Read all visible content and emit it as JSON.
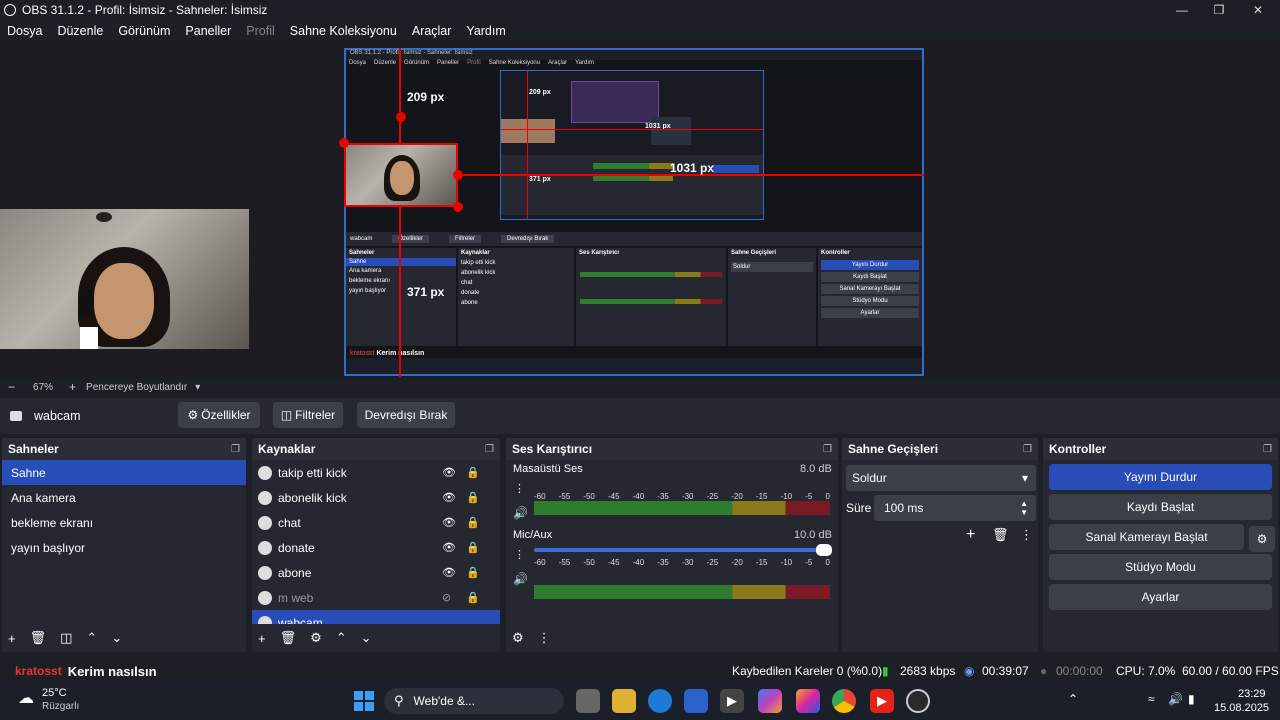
{
  "titlebar": {
    "title": "OBS 31.1.2 - Profil: İsimsiz - Sahneler: İsimsiz"
  },
  "menu": [
    "Dosya",
    "Düzenle",
    "Görünüm",
    "Paneller",
    "Profil",
    "Sahne Koleksiyonu",
    "Araçlar",
    "Yardım"
  ],
  "preview": {
    "measure_top": "209 px",
    "measure_bottom": "371 px",
    "measure_right": "1031 px",
    "inner_menu": [
      "Dosya",
      "Düzenle",
      "Görünüm",
      "Paneller",
      "Profil",
      "Sahne Koleksiyonu",
      "Araçlar",
      "Yardım"
    ],
    "inner_source": "wabcam",
    "inner_chat_user": "kratosst",
    "inner_chat_msg": "Kerim nasılsın"
  },
  "zoom": {
    "value": "67%",
    "mode": "Pencereye Boyutlandır"
  },
  "source_bar": {
    "name": "wabcam",
    "properties": "Özellikler",
    "filters": "Filtreler",
    "disable": "Devredışı Bırak"
  },
  "scenes": {
    "title": "Sahneler",
    "items": [
      "Sahne",
      "Ana kamera",
      "bekleme ekranı",
      "yayın başlıyor"
    ]
  },
  "sources": {
    "title": "Kaynaklar",
    "items": [
      "takip etti kick",
      "abonelik kick",
      "chat",
      "donate",
      "abone",
      "m web",
      "wabcam"
    ]
  },
  "mixer": {
    "title": "Ses Karıştırıcı",
    "channels": [
      {
        "name": "Masaüstü Ses",
        "db": "8.0 dB"
      },
      {
        "name": "Mic/Aux",
        "db": "10.0 dB"
      }
    ],
    "ticks": [
      "-60",
      "-55",
      "-50",
      "-45",
      "-40",
      "-35",
      "-30",
      "-25",
      "-20",
      "-15",
      "-10",
      "-5",
      "0"
    ]
  },
  "transitions": {
    "title": "Sahne Geçişleri",
    "selected": "Soldur",
    "duration_label": "Süre",
    "duration": "100 ms"
  },
  "controls": {
    "title": "Kontroller",
    "buttons": [
      "Yayını Durdur",
      "Kaydı Başlat",
      "Sanal Kamerayı Başlat",
      "Stüdyo Modu",
      "Ayarlar"
    ]
  },
  "chat": {
    "user": "kratosst",
    "message": "Kerim nasılsın"
  },
  "status": {
    "dropped": "Kaybedilen Kareler 0 (%0.0)",
    "kbps": "2683 kbps",
    "live_time": "00:39:07",
    "rec_time": "00:00:00",
    "cpu": "CPU: 7.0%",
    "fps": "60.00 / 60.00 FPS"
  },
  "taskbar": {
    "weather_temp": "25°C",
    "weather_desc": "Rüzgarlı",
    "search": "Web'de &...",
    "time": "23:29",
    "date": "15.08.2025"
  },
  "colors": {
    "accent": "#284cb8",
    "bg": "#1d1f26",
    "panel": "#252830",
    "guide": "#e00000"
  }
}
